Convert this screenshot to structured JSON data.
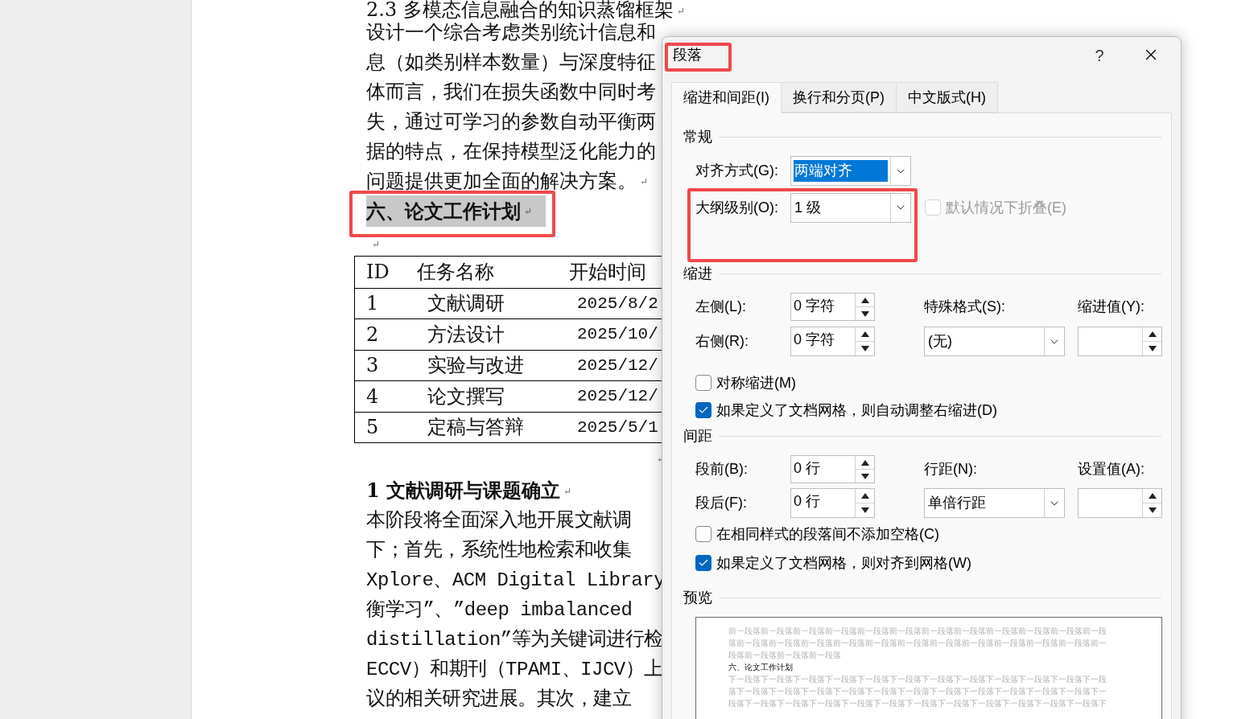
{
  "document": {
    "lines": [
      {
        "text": "2.3 多模态信息融合的知识蒸馏框架",
        "mark": "↵"
      },
      {
        "text": "设计一个综合考虑类别统计信息和"
      },
      {
        "text": "息（如类别样本数量）与深度特征"
      },
      {
        "text": "体而言，我们在损失函数中同时考"
      },
      {
        "text": "失，通过可学习的参数自动平衡两"
      },
      {
        "text": "据的特点，在保持模型泛化能力的"
      },
      {
        "text": "问题提供更加全面的解决方案。",
        "mark": "↵"
      }
    ],
    "heading": {
      "text": "六、论文工作计划",
      "mark": "↵",
      "highlighted": true,
      "annotated": true
    },
    "blank_mark": "↵",
    "table": {
      "columns": [
        "ID",
        "任务名称",
        "开始时间"
      ],
      "rows": [
        [
          "1",
          "文献调研",
          "2025/8/2"
        ],
        [
          "2",
          "方法设计",
          "2025/10/"
        ],
        [
          "3",
          "实验与改进",
          "2025/12/"
        ],
        [
          "4",
          "论文撰写",
          "2025/12/"
        ],
        [
          "5",
          "定稿与答辩",
          "2025/5/1"
        ]
      ]
    },
    "after_table_mark": "↵",
    "subheading": {
      "text": "1 文献调研与课题确立",
      "mark": "↵"
    },
    "paragraph_lines": [
      "本阶段将全面深入地开展文献调",
      "下；首先，系统性地检索和收集",
      "Xplore、ACM Digital Library",
      "衡学习”、”deep imbalanced",
      "distillation”等为关键词进行检",
      "ECCV）和期刊（TPAMI、IJCV）上",
      "议的相关研究进展。其次，建立"
    ]
  },
  "dialog": {
    "title": "段落",
    "title_annotated": true,
    "help": "?",
    "tabs": [
      {
        "label": "缩进和间距(I)",
        "selected": true
      },
      {
        "label": "换行和分页(P)",
        "selected": false
      },
      {
        "label": "中文版式(H)",
        "selected": false
      }
    ],
    "general": {
      "heading": "常规",
      "alignment": {
        "label": "对齐方式(G):",
        "value": "两端对齐",
        "highlighted": true
      },
      "outline_level": {
        "label": "大纲级别(O):",
        "value": "1 级",
        "annotated": true
      },
      "collapse": {
        "label": "默认情况下折叠(E)",
        "checked": false,
        "disabled": true
      }
    },
    "indent": {
      "heading": "缩进",
      "left": {
        "label": "左侧(L):",
        "value": "0 字符"
      },
      "right": {
        "label": "右侧(R):",
        "value": "0 字符"
      },
      "special": {
        "label": "特殊格式(S):",
        "value": "(无)"
      },
      "by": {
        "label": "缩进值(Y):"
      },
      "options": [
        {
          "label": "对称缩进(M)",
          "checked": false
        },
        {
          "label": "如果定义了文档网格，则自动调整右缩进(D)",
          "checked": true
        }
      ]
    },
    "spacing": {
      "heading": "间距",
      "before": {
        "label": "段前(B):",
        "value": "0 行"
      },
      "after": {
        "label": "段后(F):",
        "value": "0 行"
      },
      "line": {
        "label": "行距(N):",
        "value": "单倍行距"
      },
      "at": {
        "label": "设置值(A):"
      },
      "options": [
        {
          "label": "在相同样式的段落间不添加空格(C)",
          "checked": false
        },
        {
          "label": "如果定义了文档网格，则对齐到网格(W)",
          "checked": true
        }
      ]
    },
    "preview": {
      "heading": "预览",
      "before_lines": [
        "前一段落前一段落前一段落前一段落前一段落前一段落前一段落前一段落前一段落前一段落前一段落前一段",
        "落前一段落前一段落前一段落前一段落前一段落前一段落前一段落前一段落前一段落前一段落前一段落前一",
        "段落前一段落前一段落前一段落"
      ],
      "current": "六、论文工作计划",
      "after_lines": [
        "下一段落下一段落下一段落下一段落下一段落下一段落下一段落下一段落下一段落下一段落下一段落下一段",
        "落下一段落下一段落下一段落下一段落下一段落下一段落下一段落下一段落下一段落下一段落下一段落下一",
        "段落下一段落下一段落下一段落下一段落下一段落下一段落下一段落下一段落下一段落下一段落下一段落下"
      ]
    }
  }
}
